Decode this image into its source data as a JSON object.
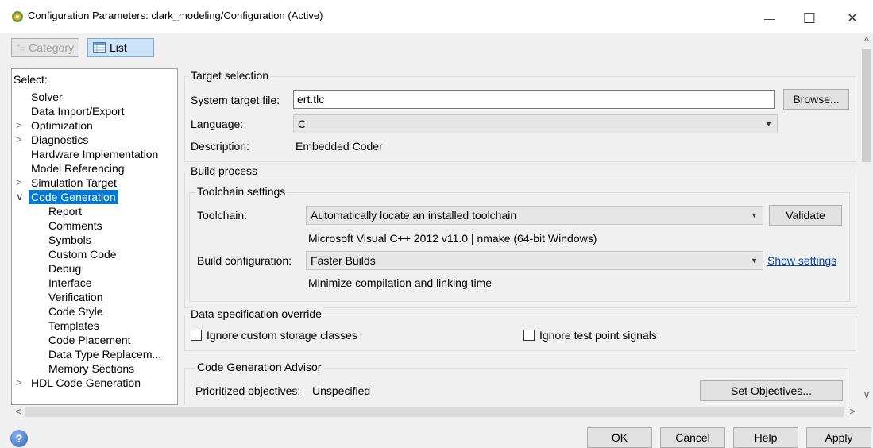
{
  "window": {
    "title": "Configuration Parameters: clark_modeling/Configuration (Active)",
    "minimize": "—",
    "maximize": "☐",
    "close": "✕"
  },
  "view_toggle": {
    "category_label": "Category",
    "list_label": "List"
  },
  "tree": {
    "header": "Select:",
    "items": [
      {
        "label": "Solver",
        "arrow": ""
      },
      {
        "label": "Data Import/Export",
        "arrow": ""
      },
      {
        "label": "Optimization",
        "arrow": ">"
      },
      {
        "label": "Diagnostics",
        "arrow": ">"
      },
      {
        "label": "Hardware Implementation",
        "arrow": ""
      },
      {
        "label": "Model Referencing",
        "arrow": ""
      },
      {
        "label": "Simulation Target",
        "arrow": ">"
      },
      {
        "label": "Code Generation",
        "arrow": "∨"
      },
      {
        "label": "Report",
        "arrow": ""
      },
      {
        "label": "Comments",
        "arrow": ""
      },
      {
        "label": "Symbols",
        "arrow": ""
      },
      {
        "label": "Custom Code",
        "arrow": ""
      },
      {
        "label": "Debug",
        "arrow": ""
      },
      {
        "label": "Interface",
        "arrow": ""
      },
      {
        "label": "Verification",
        "arrow": ""
      },
      {
        "label": "Code Style",
        "arrow": ""
      },
      {
        "label": "Templates",
        "arrow": ""
      },
      {
        "label": "Code Placement",
        "arrow": ""
      },
      {
        "label": "Data Type Replacem...",
        "arrow": ""
      },
      {
        "label": "Memory Sections",
        "arrow": ""
      },
      {
        "label": "HDL Code Generation",
        "arrow": ">"
      }
    ]
  },
  "target_selection": {
    "title": "Target selection",
    "system_target_label": "System target file:",
    "system_target_value": "ert.tlc",
    "browse_label": "Browse...",
    "language_label": "Language:",
    "language_value": "C",
    "description_label": "Description:",
    "description_value": "Embedded Coder"
  },
  "build_process": {
    "title": "Build process",
    "toolchain_settings_title": "Toolchain settings",
    "toolchain_label": "Toolchain:",
    "toolchain_value": "Automatically locate an installed toolchain",
    "validate_label": "Validate",
    "toolchain_info": "Microsoft Visual C++ 2012 v11.0 | nmake (64-bit Windows)",
    "build_config_label": "Build configuration:",
    "build_config_value": "Faster Builds",
    "show_settings_label": "Show settings",
    "build_config_info": "Minimize compilation and linking time"
  },
  "data_spec": {
    "title": "Data specification override",
    "ignore_storage_label": "Ignore custom storage classes",
    "ignore_storage_checked": false,
    "ignore_test_points_label": "Ignore test point signals",
    "ignore_test_points_checked": false
  },
  "advisor": {
    "title": "Code Generation Advisor",
    "prioritized_label": "Prioritized objectives:",
    "prioritized_value": "Unspecified",
    "set_objectives_label": "Set Objectives..."
  },
  "footer": {
    "help_icon": "?",
    "ok_label": "OK",
    "cancel_label": "Cancel",
    "help_label": "Help",
    "apply_label": "Apply"
  },
  "scroll": {
    "up": "^",
    "down": "∨",
    "left": "<",
    "right": ">"
  },
  "colors": {
    "selection": "#0078d7",
    "link": "#0645ad",
    "window_bg": "#f0f0f0"
  }
}
